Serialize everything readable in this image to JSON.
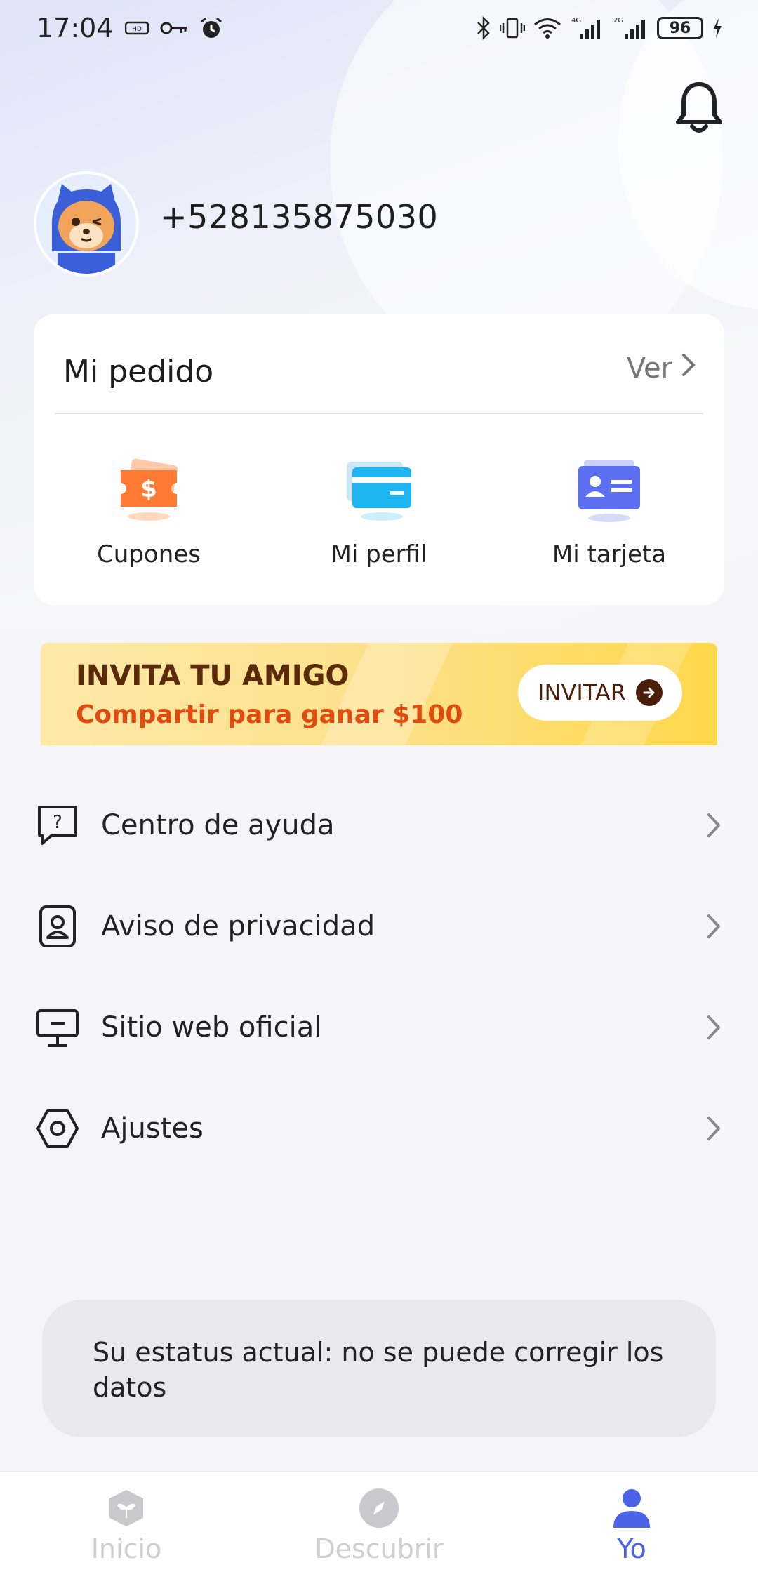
{
  "status_bar": {
    "time": "17:04",
    "network_4g": "4G",
    "network_2g": "2G",
    "battery": "96"
  },
  "header": {
    "notification_icon": "bell-icon"
  },
  "profile": {
    "phone": "+528135875030",
    "avatar_icon": "hamster-mascot-avatar"
  },
  "order_card": {
    "title": "Mi pedido",
    "view_label": "Ver",
    "items": [
      {
        "label": "Cupones",
        "icon": "coupon-icon",
        "color": "#ff7a33"
      },
      {
        "label": "Mi perfil",
        "icon": "card-icon",
        "color": "#1fb5f0"
      },
      {
        "label": "Mi tarjeta",
        "icon": "id-card-icon",
        "color": "#5b6ff0"
      }
    ]
  },
  "invite": {
    "title": "INVITA TU AMIGO",
    "subtitle": "Compartir para ganar $100",
    "button_label": "INVITAR"
  },
  "menu": [
    {
      "label": "Centro de ayuda",
      "icon": "help-icon"
    },
    {
      "label": "Aviso de privacidad",
      "icon": "privacy-icon"
    },
    {
      "label": "Sitio web oficial",
      "icon": "monitor-icon"
    },
    {
      "label": "Ajustes",
      "icon": "settings-icon"
    }
  ],
  "status_message": "Su estatus actual: no se puede corregir los datos",
  "bottom_nav": [
    {
      "label": "Inicio",
      "icon": "home-icon",
      "active": false
    },
    {
      "label": "Descubrir",
      "icon": "compass-icon",
      "active": false
    },
    {
      "label": "Yo",
      "icon": "user-icon",
      "active": true
    }
  ],
  "colors": {
    "accent": "#4a63e8",
    "invite_title": "#5a2a0a",
    "invite_sub": "#e04b10"
  }
}
